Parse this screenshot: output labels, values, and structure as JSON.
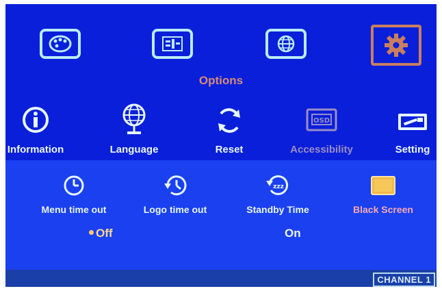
{
  "menu": {
    "top_icons": [
      {
        "name": "palette-icon",
        "active": false
      },
      {
        "name": "equalizer-icon",
        "active": false
      },
      {
        "name": "globe-window-icon",
        "active": false
      },
      {
        "name": "gear-icon",
        "active": true
      }
    ],
    "title": "Options"
  },
  "submenu": {
    "items": [
      {
        "label": "Information",
        "icon": "info-icon"
      },
      {
        "label": "Language",
        "icon": "globe-icon"
      },
      {
        "label": "Reset",
        "icon": "reset-icon"
      },
      {
        "label": "Accessibility",
        "icon": "osd-icon",
        "dim": true
      },
      {
        "label": "Setting",
        "icon": "settings-tool-icon"
      }
    ]
  },
  "options": {
    "items": [
      {
        "label": "Menu time out",
        "icon": "clock-icon"
      },
      {
        "label": "Logo time out",
        "icon": "history-clock-icon"
      },
      {
        "label": "Standby Time",
        "icon": "standby-zzz-icon"
      },
      {
        "label": "Black Screen",
        "icon": "black-screen-icon",
        "selected": true
      }
    ],
    "values": [
      {
        "label": "Off",
        "selected": true
      },
      {
        "label": "On",
        "selected": false
      }
    ]
  },
  "status": {
    "channel": "CHANNEL 1"
  },
  "colors": {
    "background": "#0a1fd9",
    "highlight_panel": "#1a40f0",
    "active_accent": "#c97e5f",
    "selected_text": "#f6a8b6"
  }
}
